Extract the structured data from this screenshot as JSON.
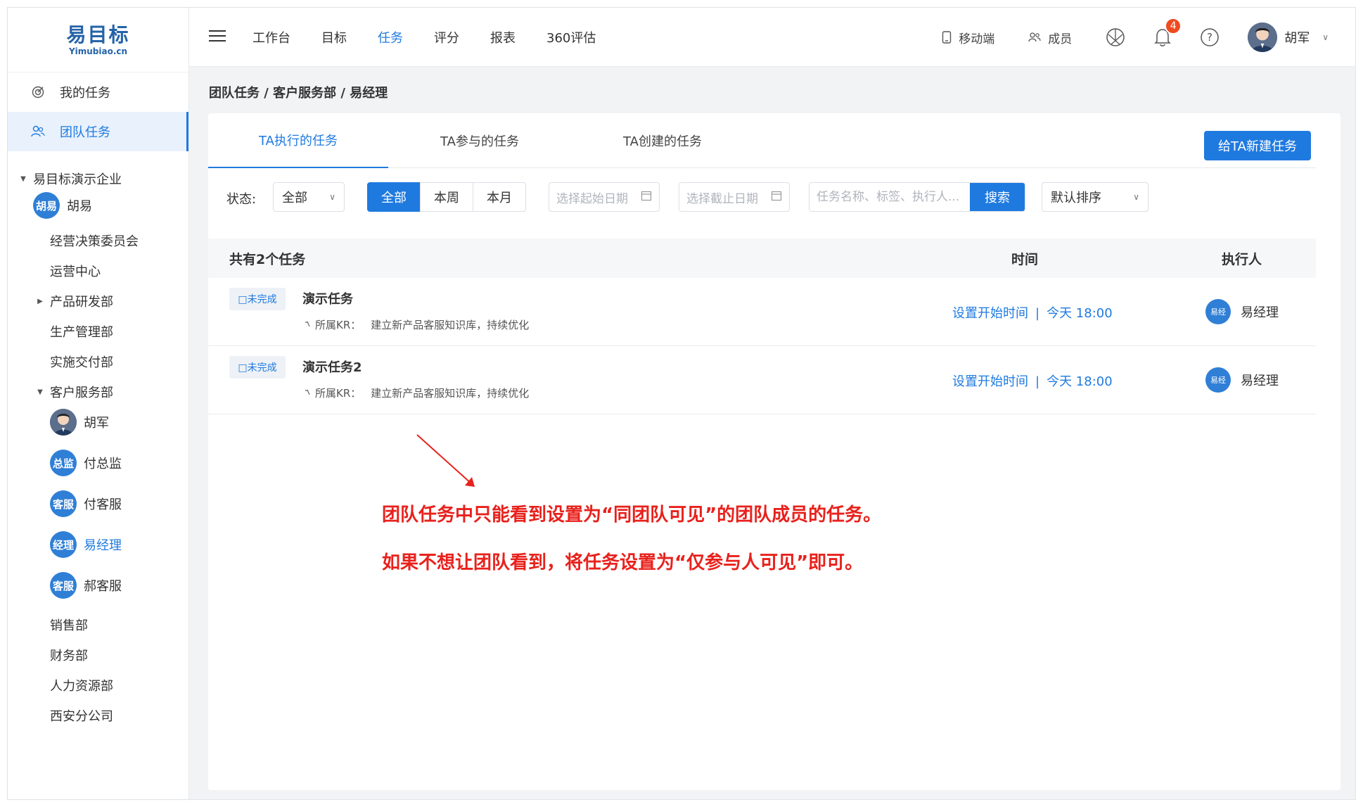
{
  "logo": {
    "cn": "易目标",
    "en": "Yimubiao.cn"
  },
  "sidebar": {
    "menu": [
      {
        "label": "我的任务",
        "icon": "target-icon"
      },
      {
        "label": "团队任务",
        "icon": "team-icon",
        "active": true
      }
    ],
    "tree": {
      "company": "易目标演示企业",
      "leader_initials": "胡易",
      "leader": "胡易",
      "depts": [
        "经营决策委员会",
        "运营中心",
        "产品研发部",
        "生产管理部",
        "实施交付部",
        "客户服务部"
      ],
      "members": [
        {
          "name": "胡军",
          "initials": ""
        },
        {
          "name": "付总监",
          "initials": "总监"
        },
        {
          "name": "付客服",
          "initials": "客服"
        },
        {
          "name": "易经理",
          "initials": "经理"
        },
        {
          "name": "郝客服",
          "initials": "客服"
        }
      ],
      "depts_after": [
        "销售部",
        "财务部",
        "人力资源部",
        "西安分公司"
      ]
    }
  },
  "topnav": {
    "items": [
      "工作台",
      "目标",
      "任务",
      "评分",
      "报表",
      "360评估"
    ],
    "active": "任务",
    "mobile": "移动端",
    "members": "成员",
    "notification_count": "4",
    "user": "胡军"
  },
  "breadcrumb": "团队任务 / 客户服务部 / 易经理",
  "tabs": [
    "TA执行的任务",
    "TA参与的任务",
    "TA创建的任务"
  ],
  "new_task_button": "给TA新建任务",
  "filters": {
    "status_label": "状态:",
    "status_value": "全部",
    "range": [
      "全部",
      "本周",
      "本月"
    ],
    "start_date_placeholder": "选择起始日期",
    "end_date_placeholder": "选择截止日期",
    "search_placeholder": "任务名称、标签、执行人...",
    "search_button": "搜索",
    "sort_value": "默认排序"
  },
  "table": {
    "count_label": "共有2个任务",
    "col_time": "时间",
    "col_exec": "执行人",
    "rows": [
      {
        "status": "□未完成",
        "title": "演示任务",
        "kr_label": "所属KR：",
        "kr": "建立新产品客服知识库，持续优化",
        "start": "设置开始时间",
        "sep": "|",
        "end": "今天 18:00",
        "exec_initials": "易经",
        "exec": "易经理"
      },
      {
        "status": "□未完成",
        "title": "演示任务2",
        "kr_label": "所属KR：",
        "kr": "建立新产品客服知识库，持续优化",
        "start": "设置开始时间",
        "sep": "|",
        "end": "今天 18:00",
        "exec_initials": "易经",
        "exec": "易经理"
      }
    ]
  },
  "annotation": {
    "line1": "团队任务中只能看到设置为“同团队可见”的团队成员的任务。",
    "line2": "如果不想让团队看到，将任务设置为“仅参与人可见”即可。"
  },
  "colors": {
    "accent": "#1f7ae0",
    "note": "#e8211c",
    "badge": "#f04a1f"
  }
}
